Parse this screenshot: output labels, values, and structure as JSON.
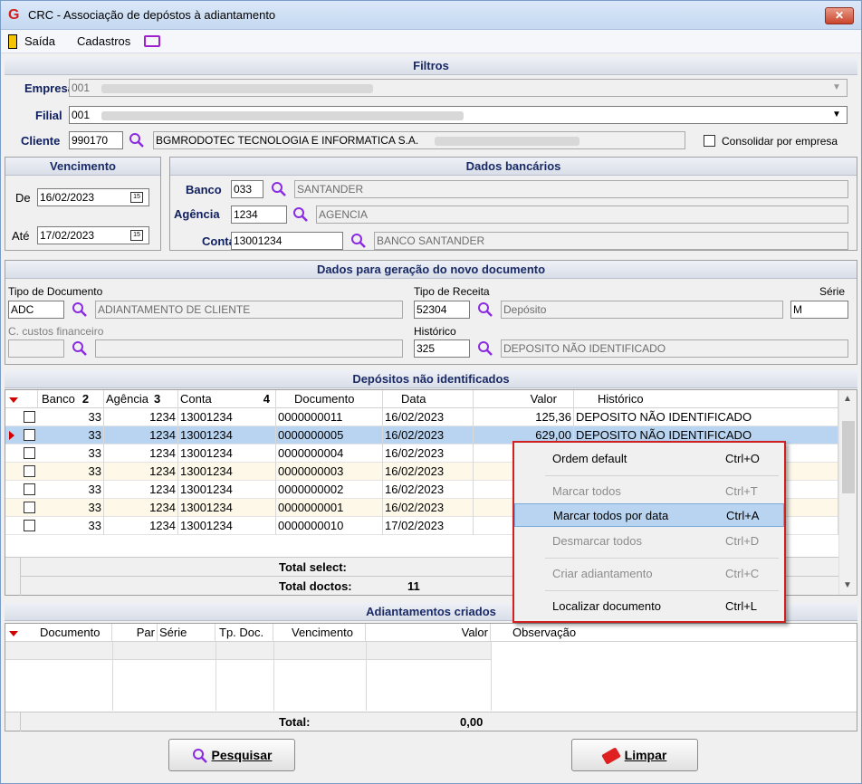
{
  "window": {
    "title": "CRC - Associação de depóstos à adiantamento",
    "close_label": "✕"
  },
  "menu": {
    "exit": "Saída",
    "registers": "Cadastros"
  },
  "filters": {
    "header": "Filtros",
    "company_label": "Empresa",
    "company_value": "001",
    "branch_label": "Filial",
    "branch_value": "001",
    "client_label": "Cliente",
    "client_code": "990170",
    "client_name": "BGMRODOTEC TECNOLOGIA E INFORMATICA S.A.",
    "consolidate_label": "Consolidar por empresa"
  },
  "due": {
    "header": "Vencimento",
    "from_label": "De",
    "from_value": "16/02/2023",
    "to_label": "Até",
    "to_value": "17/02/2023",
    "cal_icon": "15"
  },
  "bank": {
    "header": "Dados bancários",
    "bank_label": "Banco",
    "bank_code": "033",
    "bank_name": "SANTANDER",
    "agency_label": "Agência",
    "agency_code": "1234",
    "agency_name": "AGENCIA",
    "account_label": "Conta",
    "account_code": "13001234",
    "account_name": "BANCO SANTANDER"
  },
  "newdoc": {
    "header": "Dados para geração do novo documento",
    "doctype_label": "Tipo de Documento",
    "doctype_code": "ADC",
    "doctype_name": "ADIANTAMENTO DE CLIENTE",
    "revtype_label": "Tipo de Receita",
    "revtype_code": "52304",
    "revtype_name": "Depósito",
    "serie_label": "Série",
    "serie_value": "M",
    "cost_label": "C. custos financeiro",
    "history_label": "Histórico",
    "history_code": "325",
    "history_name": "DEPOSITO NÃO IDENTIFICADO"
  },
  "deposits": {
    "header": "Depósitos não identificados",
    "columns": {
      "bank": "Banco",
      "bank_sort": "2",
      "agency": "Agência",
      "agency_sort": "3",
      "account": "Conta",
      "account_sort": "4",
      "document": "Documento",
      "date": "Data",
      "value": "Valor",
      "history": "Histórico"
    },
    "rows": [
      {
        "bank": "33",
        "agency": "1234",
        "account": "13001234",
        "document": "0000000011",
        "date": "16/02/2023",
        "value": "125,36",
        "history": "DEPOSITO NÃO IDENTIFICADO"
      },
      {
        "bank": "33",
        "agency": "1234",
        "account": "13001234",
        "document": "0000000005",
        "date": "16/02/2023",
        "value": "629,00",
        "history": "DEPOSITO NÃO IDENTIFICADO"
      },
      {
        "bank": "33",
        "agency": "1234",
        "account": "13001234",
        "document": "0000000004",
        "date": "16/02/2023",
        "value": "",
        "history": ""
      },
      {
        "bank": "33",
        "agency": "1234",
        "account": "13001234",
        "document": "0000000003",
        "date": "16/02/2023",
        "value": "",
        "history": ""
      },
      {
        "bank": "33",
        "agency": "1234",
        "account": "13001234",
        "document": "0000000002",
        "date": "16/02/2023",
        "value": "",
        "history": ""
      },
      {
        "bank": "33",
        "agency": "1234",
        "account": "13001234",
        "document": "0000000001",
        "date": "16/02/2023",
        "value": "",
        "history": ""
      },
      {
        "bank": "33",
        "agency": "1234",
        "account": "13001234",
        "document": "0000000010",
        "date": "17/02/2023",
        "value": "",
        "history": ""
      }
    ],
    "total_select_label": "Total select:",
    "total_docs_label": "Total doctos:",
    "total_docs_value": "11"
  },
  "advances": {
    "header": "Adiantamentos criados",
    "columns": {
      "document": "Documento",
      "par": "Par",
      "serie": "Série",
      "doc_type": "Tp. Doc.",
      "due": "Vencimento",
      "value": "Valor",
      "note": "Observação"
    },
    "total_label": "Total:",
    "total_value": "0,00"
  },
  "buttons": {
    "search_label": "Pesquisar",
    "clear_label": "Limpar"
  },
  "context_menu": {
    "items": [
      {
        "label": "Ordem default",
        "shortcut": "Ctrl+O"
      },
      {
        "label": "Marcar todos",
        "shortcut": "Ctrl+T"
      },
      {
        "label": "Marcar todos por data",
        "shortcut": "Ctrl+A"
      },
      {
        "label": "Desmarcar todos",
        "shortcut": "Ctrl+D"
      },
      {
        "label": "Criar adiantamento",
        "shortcut": "Ctrl+C"
      },
      {
        "label": "Localizar documento",
        "shortcut": "Ctrl+L"
      }
    ]
  },
  "colors": {
    "accent": "#1a2a66",
    "selection": "#b8d4f0",
    "menu_border": "#d02020",
    "search_icon": "#8a2be2"
  }
}
